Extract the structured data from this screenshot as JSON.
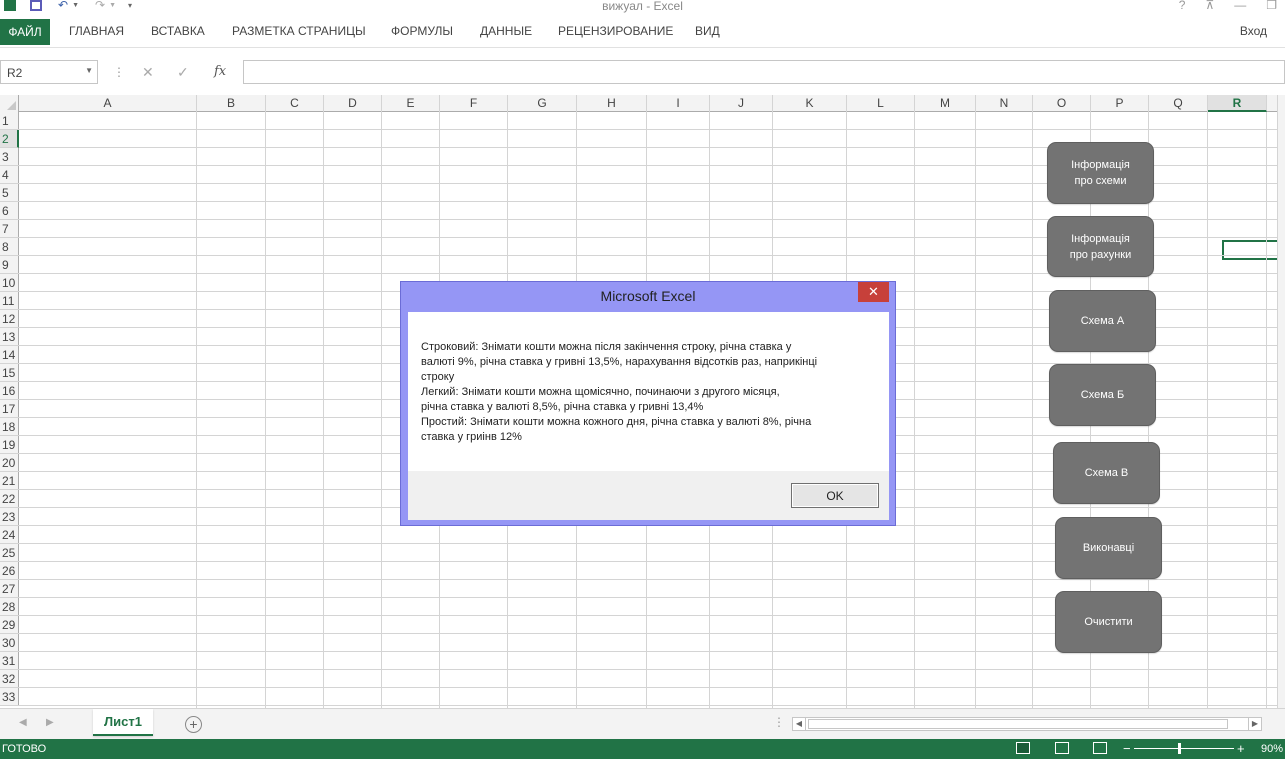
{
  "window": {
    "title": "вижуал - Excel",
    "help_icon": "?",
    "minimize_icon": "—",
    "restore_icon": "❐"
  },
  "ribbon": {
    "file_tab": "ФАЙЛ",
    "tabs": [
      "ГЛАВНАЯ",
      "ВСТАВКА",
      "РАЗМЕТКА СТРАНИЦЫ",
      "ФОРМУЛЫ",
      "ДАННЫЕ",
      "РЕЦЕНЗИРОВАНИЕ",
      "ВИД"
    ],
    "signin": "Вход"
  },
  "formula_bar": {
    "name_box": "R2",
    "fx_label": "fx",
    "value": ""
  },
  "grid": {
    "columns": [
      "A",
      "B",
      "C",
      "D",
      "E",
      "F",
      "G",
      "H",
      "I",
      "J",
      "K",
      "L",
      "M",
      "N",
      "O",
      "P",
      "Q",
      "R"
    ],
    "selected_column": "R",
    "rows": [
      "1",
      "2",
      "3",
      "4",
      "5",
      "6",
      "7",
      "8",
      "9",
      "10",
      "11",
      "12",
      "13",
      "14",
      "15",
      "16",
      "17",
      "18",
      "19",
      "20",
      "21",
      "22",
      "23",
      "24",
      "25",
      "26",
      "27",
      "28",
      "29",
      "30",
      "31",
      "32",
      "33"
    ],
    "selected_row": "2"
  },
  "shapes": [
    {
      "label": "Інформація\nпро схеми"
    },
    {
      "label": "Інформація\nпро рахунки"
    },
    {
      "label": "Схема А"
    },
    {
      "label": "Схема Б"
    },
    {
      "label": "Схема В"
    },
    {
      "label": "Виконавці"
    },
    {
      "label": "Очистити"
    }
  ],
  "sheets": {
    "active": "Лист1",
    "add_label": "+"
  },
  "status": {
    "ready": "ГОТОВО",
    "zoom": "90%",
    "zoom_minus": "−",
    "zoom_plus": "+"
  },
  "dialog": {
    "title": "Microsoft Excel",
    "close_label": "✕",
    "message": "Строковий: Знімати кошти можна після закінчення строку, річна ставка у\nвалюті 9%, річна ставка у гривні 13,5%, нарахування відсотків раз, наприкінці\nстроку\nЛегкий: Знімати кошти можна щомісячно, починаючи з другого місяця,\nрічна ставка у валюті 8,5%, річна ставка у гривні 13,4%\nПростий: Знімати кошти можна кожного дня, річна ставка у валюті 8%, річна\nставка у гриінв 12%",
    "ok_label": "OK"
  }
}
